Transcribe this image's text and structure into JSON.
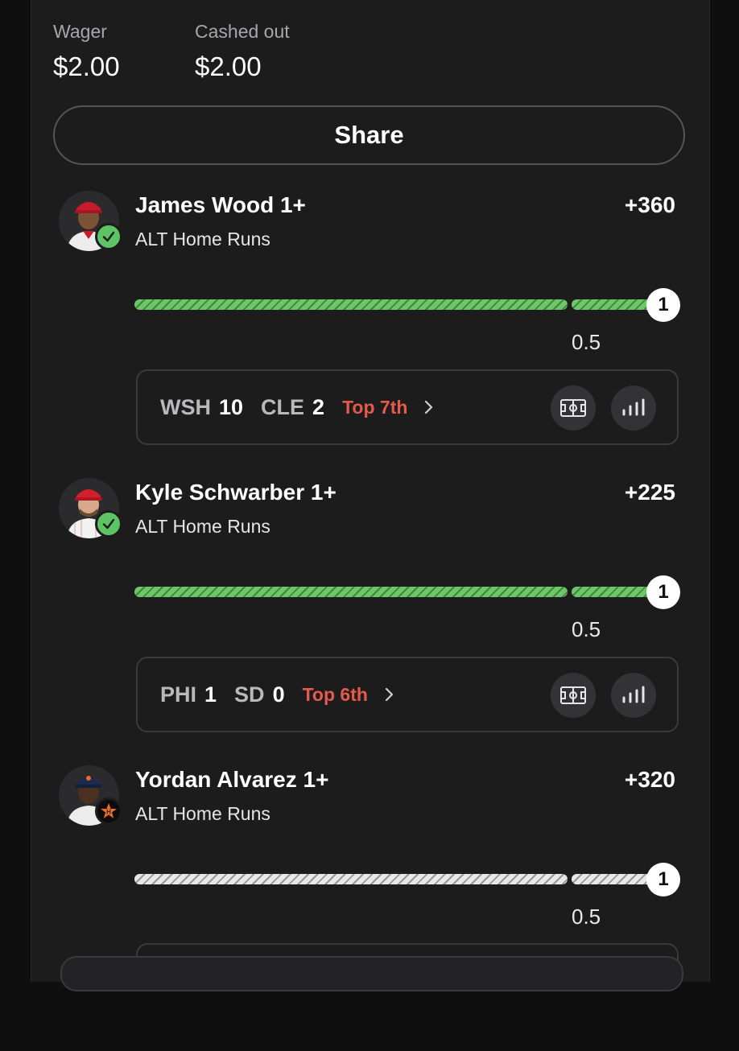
{
  "summary": {
    "wager_label": "Wager",
    "wager_value": "$2.00",
    "cashed_label": "Cashed out",
    "cashed_value": "$2.00"
  },
  "share_label": "Share",
  "legs": [
    {
      "player": "James Wood 1+",
      "market": "ALT Home Runs",
      "odds": "+360",
      "status": "won",
      "status_icon": "check-icon",
      "progress_color": "#6cc866",
      "progress_fraction": 1.0,
      "target": "1",
      "line": "0.5",
      "game": {
        "away_team": "WSH",
        "away_score": "10",
        "home_team": "CLE",
        "home_score": "2",
        "inning": "Top 7th"
      }
    },
    {
      "player": "Kyle Schwarber 1+",
      "market": "ALT Home Runs",
      "odds": "+225",
      "status": "won",
      "status_icon": "check-icon",
      "progress_color": "#6cc866",
      "progress_fraction": 1.0,
      "target": "1",
      "line": "0.5",
      "game": {
        "away_team": "PHI",
        "away_score": "1",
        "home_team": "SD",
        "home_score": "0",
        "inning": "Top 6th"
      }
    },
    {
      "player": "Yordan Alvarez 1+",
      "market": "ALT Home Runs",
      "odds": "+320",
      "status": "pending",
      "status_icon": "astros-logo-icon",
      "progress_color": "#e8e8e8",
      "progress_fraction": 0.0,
      "target": "1",
      "line": "0.5"
    }
  ],
  "colors": {
    "accent_green": "#5cc464",
    "inning_red": "#e55a4c",
    "background": "#1c1c1d"
  }
}
